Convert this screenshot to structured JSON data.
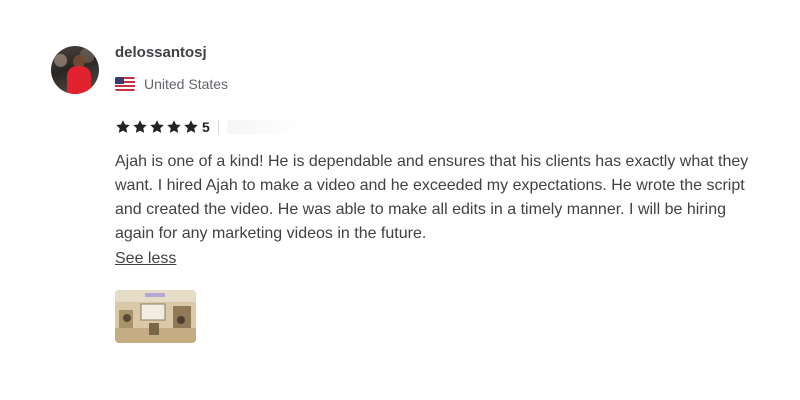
{
  "review": {
    "username": "delossantosj",
    "country": "United States",
    "rating": "5",
    "stars_filled": 5,
    "text": "Ajah is one of a kind! He is dependable and ensures that his clients has exactly what they want. I hired Ajah to make a video and he exceeded my expectations. He wrote the script and created the video. He was able to make all edits in a timely manner. I will be hiring again for any marketing videos in the future.",
    "see_less_label": "See less"
  },
  "icons": {
    "avatar": "user-avatar-photo",
    "flag": "us-flag-icon",
    "star": "star-icon",
    "thumbnail": "video-thumbnail"
  },
  "colors": {
    "text": "#404145",
    "secondary_text": "#62646a",
    "star": "#222325"
  }
}
